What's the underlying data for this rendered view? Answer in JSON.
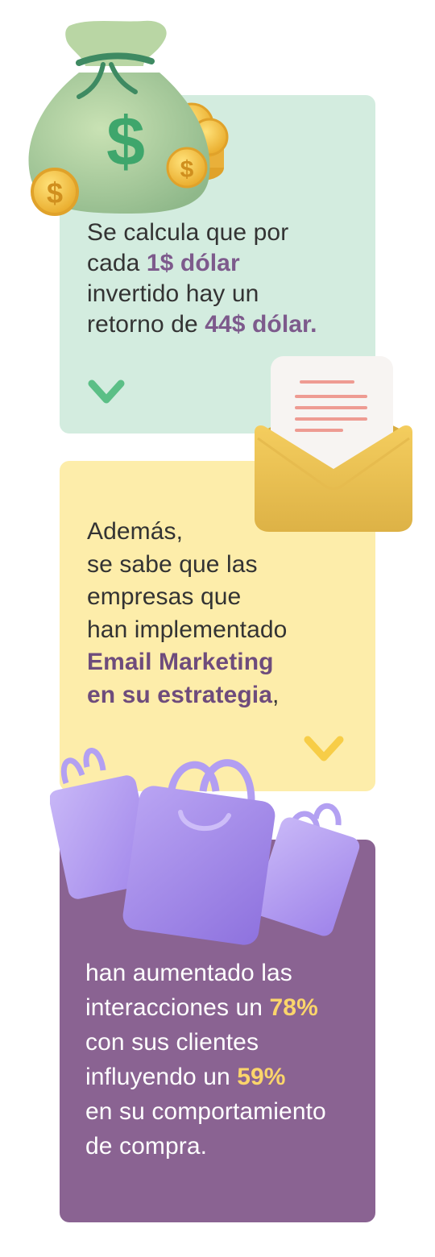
{
  "green_card": {
    "line1": "Se calcula que por",
    "line2_pre": "cada ",
    "line2_hl": "1$ dólar",
    "line3": "invertido hay un",
    "line4_pre": "retorno de ",
    "line4_hl": "44$ dólar."
  },
  "yellow_card": {
    "line1": "Además,",
    "line2": "se sabe que las",
    "line3": "empresas que",
    "line4": "han implementado",
    "line5_hl": "Email Marketing",
    "line6_hl": "en su estrategia",
    "line6_post": ","
  },
  "purple_card": {
    "line1": "han aumentado las",
    "line2_pre": "interacciones un ",
    "line2_hl": "78%",
    "line3": "con sus clientes",
    "line4_pre": "influyendo un ",
    "line4_hl": "59%",
    "line5": "en su comportamiento",
    "line6": "de compra."
  },
  "colors": {
    "green_card_bg": "#d3ecdf",
    "yellow_card_bg": "#fdedaa",
    "purple_card_bg": "#8a6392",
    "highlight_purple": "#7d5a8c",
    "highlight_yellow": "#fbd56b",
    "chevron_green": "#5bbf86",
    "chevron_yellow": "#f7cd47"
  },
  "icons": {
    "money": "money-bag-icon",
    "coin": "coin-icon",
    "envelope": "envelope-letter-icon",
    "bags": "shopping-bags-icon",
    "chevron": "chevron-down-icon"
  }
}
